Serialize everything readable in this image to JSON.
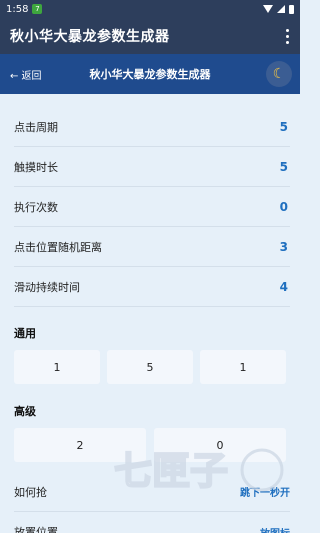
{
  "status": {
    "time": "1:58",
    "notif_glyph": "7"
  },
  "app": {
    "title": "秋小华大暴龙参数生成器"
  },
  "nav": {
    "back_label": "← 返回",
    "title": "秋小华大暴龙参数生成器",
    "theme_icon": "moon-icon"
  },
  "params": [
    {
      "label": "点击周期",
      "value": "5"
    },
    {
      "label": "触摸时长",
      "value": "5"
    },
    {
      "label": "执行次数",
      "value": "0"
    },
    {
      "label": "点击位置随机距离",
      "value": "3"
    },
    {
      "label": "滑动持续时间",
      "value": "4"
    }
  ],
  "general": {
    "title": "通用",
    "values": [
      "1",
      "5",
      "1"
    ]
  },
  "advanced": {
    "title": "高级",
    "values": [
      "2",
      "0"
    ]
  },
  "howto": {
    "label": "如何抢",
    "link": "跳下一秒开"
  },
  "placement": {
    "label": "放置位置",
    "link": "放图标"
  },
  "watermark": {
    "text": "七匣子"
  },
  "colors": {
    "header": "#2d3e5c",
    "nav": "#1f4b8e",
    "accent": "#1f6fbf",
    "background": "#e6f0f9"
  }
}
